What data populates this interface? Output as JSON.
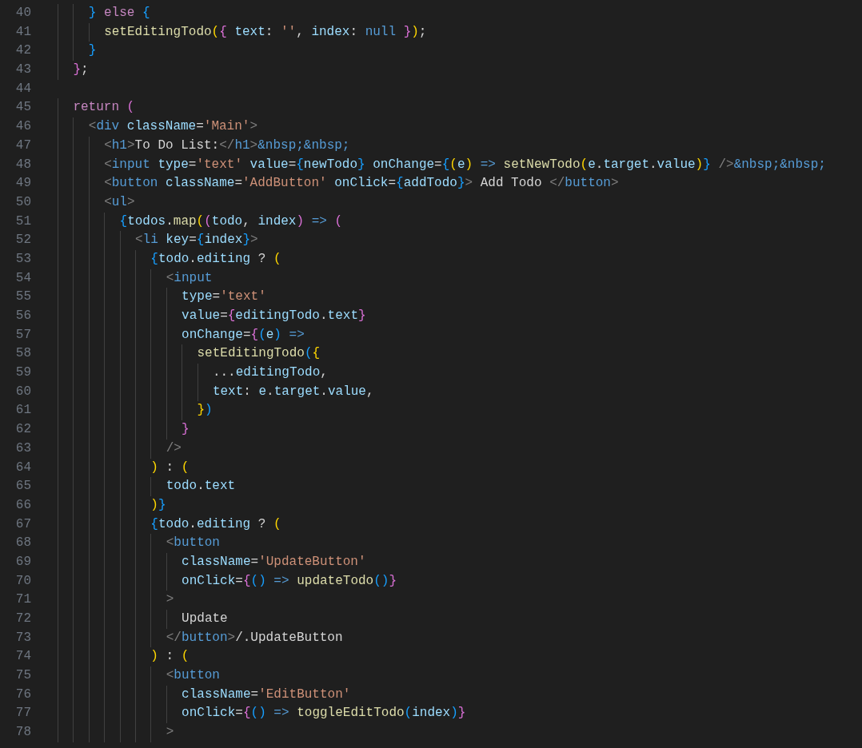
{
  "editor": {
    "lines": [
      {
        "number": "40",
        "tokens": [
          {
            "kind": "b3",
            "text": "      }"
          },
          {
            "kind": "kw",
            "text": " else "
          },
          {
            "kind": "b3",
            "text": "{"
          }
        ]
      },
      {
        "number": "41",
        "tokens": [
          {
            "kind": "fn",
            "text": "        setEditingTodo"
          },
          {
            "kind": "b1",
            "text": "("
          },
          {
            "kind": "b2",
            "text": "{ "
          },
          {
            "kind": "var",
            "text": "text"
          },
          {
            "kind": "plain",
            "text": ": "
          },
          {
            "kind": "str",
            "text": "''"
          },
          {
            "kind": "plain",
            "text": ", "
          },
          {
            "kind": "var",
            "text": "index"
          },
          {
            "kind": "plain",
            "text": ": "
          },
          {
            "kind": "const",
            "text": "null "
          },
          {
            "kind": "b2",
            "text": "}"
          },
          {
            "kind": "b1",
            "text": ")"
          },
          {
            "kind": "plain",
            "text": ";"
          }
        ]
      },
      {
        "number": "42",
        "tokens": [
          {
            "kind": "b3",
            "text": "      }"
          }
        ]
      },
      {
        "number": "43",
        "tokens": [
          {
            "kind": "b2",
            "text": "    }"
          },
          {
            "kind": "plain",
            "text": ";"
          }
        ]
      },
      {
        "number": "44"
      },
      {
        "number": "45",
        "tokens": [
          {
            "kind": "kw",
            "text": "    return "
          },
          {
            "kind": "b2",
            "text": "("
          }
        ]
      },
      {
        "number": "46",
        "tokens": [
          {
            "kind": "punct",
            "text": "      <"
          },
          {
            "kind": "tag",
            "text": "div "
          },
          {
            "kind": "var",
            "text": "className"
          },
          {
            "kind": "plain",
            "text": "="
          },
          {
            "kind": "str",
            "text": "'Main'"
          },
          {
            "kind": "punct",
            "text": ">"
          }
        ]
      },
      {
        "number": "47",
        "tokens": [
          {
            "kind": "punct",
            "text": "        <"
          },
          {
            "kind": "tag",
            "text": "h1"
          },
          {
            "kind": "punct",
            "text": ">"
          },
          {
            "kind": "plain",
            "text": "To Do List:"
          },
          {
            "kind": "punct",
            "text": "</"
          },
          {
            "kind": "tag",
            "text": "h1"
          },
          {
            "kind": "punct",
            "text": ">"
          },
          {
            "kind": "tag",
            "text": "&nbsp;&nbsp;"
          }
        ]
      },
      {
        "number": "48",
        "tokens": [
          {
            "kind": "punct",
            "text": "        <"
          },
          {
            "kind": "tag",
            "text": "input "
          },
          {
            "kind": "var",
            "text": "type"
          },
          {
            "kind": "plain",
            "text": "="
          },
          {
            "kind": "str",
            "text": "'text' "
          },
          {
            "kind": "var",
            "text": "value"
          },
          {
            "kind": "plain",
            "text": "="
          },
          {
            "kind": "b3",
            "text": "{"
          },
          {
            "kind": "var",
            "text": "newTodo"
          },
          {
            "kind": "b3",
            "text": "} "
          },
          {
            "kind": "var",
            "text": "onChange"
          },
          {
            "kind": "plain",
            "text": "="
          },
          {
            "kind": "b3",
            "text": "{"
          },
          {
            "kind": "b1",
            "text": "("
          },
          {
            "kind": "var",
            "text": "e"
          },
          {
            "kind": "b1",
            "text": ") "
          },
          {
            "kind": "arrow",
            "text": "=> "
          },
          {
            "kind": "fn",
            "text": "setNewTodo"
          },
          {
            "kind": "b1",
            "text": "("
          },
          {
            "kind": "var",
            "text": "e"
          },
          {
            "kind": "plain",
            "text": "."
          },
          {
            "kind": "var",
            "text": "target"
          },
          {
            "kind": "plain",
            "text": "."
          },
          {
            "kind": "var",
            "text": "value"
          },
          {
            "kind": "b1",
            "text": ")"
          },
          {
            "kind": "b3",
            "text": "} "
          },
          {
            "kind": "punct",
            "text": "/>"
          },
          {
            "kind": "tag",
            "text": "&nbsp;&nbsp;"
          }
        ]
      },
      {
        "number": "49",
        "tokens": [
          {
            "kind": "punct",
            "text": "        <"
          },
          {
            "kind": "tag",
            "text": "button "
          },
          {
            "kind": "var",
            "text": "className"
          },
          {
            "kind": "plain",
            "text": "="
          },
          {
            "kind": "str",
            "text": "'AddButton' "
          },
          {
            "kind": "var",
            "text": "onClick"
          },
          {
            "kind": "plain",
            "text": "="
          },
          {
            "kind": "b3",
            "text": "{"
          },
          {
            "kind": "var",
            "text": "addTodo"
          },
          {
            "kind": "b3",
            "text": "}"
          },
          {
            "kind": "punct",
            "text": ">"
          },
          {
            "kind": "plain",
            "text": " Add Todo "
          },
          {
            "kind": "punct",
            "text": "</"
          },
          {
            "kind": "tag",
            "text": "button"
          },
          {
            "kind": "punct",
            "text": ">"
          }
        ]
      },
      {
        "number": "50",
        "tokens": [
          {
            "kind": "punct",
            "text": "        <"
          },
          {
            "kind": "tag",
            "text": "ul"
          },
          {
            "kind": "punct",
            "text": ">"
          }
        ]
      },
      {
        "number": "51",
        "tokens": [
          {
            "kind": "b3",
            "text": "          {"
          },
          {
            "kind": "var",
            "text": "todos"
          },
          {
            "kind": "plain",
            "text": "."
          },
          {
            "kind": "fn",
            "text": "map"
          },
          {
            "kind": "b1",
            "text": "("
          },
          {
            "kind": "b2",
            "text": "("
          },
          {
            "kind": "var",
            "text": "todo"
          },
          {
            "kind": "plain",
            "text": ", "
          },
          {
            "kind": "var",
            "text": "index"
          },
          {
            "kind": "b2",
            "text": ") "
          },
          {
            "kind": "arrow",
            "text": "=> "
          },
          {
            "kind": "b2",
            "text": "("
          }
        ]
      },
      {
        "number": "52",
        "tokens": [
          {
            "kind": "punct",
            "text": "            <"
          },
          {
            "kind": "tag",
            "text": "li "
          },
          {
            "kind": "var",
            "text": "key"
          },
          {
            "kind": "plain",
            "text": "="
          },
          {
            "kind": "b3",
            "text": "{"
          },
          {
            "kind": "var",
            "text": "index"
          },
          {
            "kind": "b3",
            "text": "}"
          },
          {
            "kind": "punct",
            "text": ">"
          }
        ]
      },
      {
        "number": "53",
        "tokens": [
          {
            "kind": "b3",
            "text": "              {"
          },
          {
            "kind": "var",
            "text": "todo"
          },
          {
            "kind": "plain",
            "text": "."
          },
          {
            "kind": "var",
            "text": "editing"
          },
          {
            "kind": "plain",
            "text": " ? "
          },
          {
            "kind": "b1",
            "text": "("
          }
        ]
      },
      {
        "number": "54",
        "tokens": [
          {
            "kind": "punct",
            "text": "                <"
          },
          {
            "kind": "tag",
            "text": "input"
          }
        ]
      },
      {
        "number": "55",
        "tokens": [
          {
            "kind": "var",
            "text": "                  type"
          },
          {
            "kind": "plain",
            "text": "="
          },
          {
            "kind": "str",
            "text": "'text'"
          }
        ]
      },
      {
        "number": "56",
        "tokens": [
          {
            "kind": "var",
            "text": "                  value"
          },
          {
            "kind": "plain",
            "text": "="
          },
          {
            "kind": "b2",
            "text": "{"
          },
          {
            "kind": "var",
            "text": "editingTodo"
          },
          {
            "kind": "plain",
            "text": "."
          },
          {
            "kind": "var",
            "text": "text"
          },
          {
            "kind": "b2",
            "text": "}"
          }
        ]
      },
      {
        "number": "57",
        "tokens": [
          {
            "kind": "var",
            "text": "                  onChange"
          },
          {
            "kind": "plain",
            "text": "="
          },
          {
            "kind": "b2",
            "text": "{"
          },
          {
            "kind": "b3",
            "text": "("
          },
          {
            "kind": "var",
            "text": "e"
          },
          {
            "kind": "b3",
            "text": ") "
          },
          {
            "kind": "arrow",
            "text": "=>"
          }
        ]
      },
      {
        "number": "58",
        "tokens": [
          {
            "kind": "fn",
            "text": "                    setEditingTodo"
          },
          {
            "kind": "b3",
            "text": "("
          },
          {
            "kind": "b1",
            "text": "{"
          }
        ]
      },
      {
        "number": "59",
        "tokens": [
          {
            "kind": "plain",
            "text": "                      ..."
          },
          {
            "kind": "var",
            "text": "editingTodo"
          },
          {
            "kind": "plain",
            "text": ","
          }
        ]
      },
      {
        "number": "60",
        "tokens": [
          {
            "kind": "var",
            "text": "                      text"
          },
          {
            "kind": "plain",
            "text": ": "
          },
          {
            "kind": "var",
            "text": "e"
          },
          {
            "kind": "plain",
            "text": "."
          },
          {
            "kind": "var",
            "text": "target"
          },
          {
            "kind": "plain",
            "text": "."
          },
          {
            "kind": "var",
            "text": "value"
          },
          {
            "kind": "plain",
            "text": ","
          }
        ]
      },
      {
        "number": "61",
        "tokens": [
          {
            "kind": "b1",
            "text": "                    }"
          },
          {
            "kind": "b3",
            "text": ")"
          }
        ]
      },
      {
        "number": "62",
        "tokens": [
          {
            "kind": "b2",
            "text": "                  }"
          }
        ]
      },
      {
        "number": "63",
        "tokens": [
          {
            "kind": "punct",
            "text": "                />"
          }
        ]
      },
      {
        "number": "64",
        "tokens": [
          {
            "kind": "b1",
            "text": "              )"
          },
          {
            "kind": "plain",
            "text": " : "
          },
          {
            "kind": "b1",
            "text": "("
          }
        ]
      },
      {
        "number": "65",
        "tokens": [
          {
            "kind": "var",
            "text": "                todo"
          },
          {
            "kind": "plain",
            "text": "."
          },
          {
            "kind": "var",
            "text": "text"
          }
        ]
      },
      {
        "number": "66",
        "tokens": [
          {
            "kind": "b1",
            "text": "              )"
          },
          {
            "kind": "b3",
            "text": "}"
          }
        ]
      },
      {
        "number": "67",
        "tokens": [
          {
            "kind": "b3",
            "text": "              {"
          },
          {
            "kind": "var",
            "text": "todo"
          },
          {
            "kind": "plain",
            "text": "."
          },
          {
            "kind": "var",
            "text": "editing"
          },
          {
            "kind": "plain",
            "text": " ? "
          },
          {
            "kind": "b1",
            "text": "("
          }
        ]
      },
      {
        "number": "68",
        "tokens": [
          {
            "kind": "punct",
            "text": "                <"
          },
          {
            "kind": "tag",
            "text": "button"
          }
        ]
      },
      {
        "number": "69",
        "tokens": [
          {
            "kind": "var",
            "text": "                  className"
          },
          {
            "kind": "plain",
            "text": "="
          },
          {
            "kind": "str",
            "text": "'UpdateButton'"
          }
        ]
      },
      {
        "number": "70",
        "tokens": [
          {
            "kind": "var",
            "text": "                  onClick"
          },
          {
            "kind": "plain",
            "text": "="
          },
          {
            "kind": "b2",
            "text": "{"
          },
          {
            "kind": "b3",
            "text": "() "
          },
          {
            "kind": "arrow",
            "text": "=> "
          },
          {
            "kind": "fn",
            "text": "updateTodo"
          },
          {
            "kind": "b3",
            "text": "()"
          },
          {
            "kind": "b2",
            "text": "}"
          }
        ]
      },
      {
        "number": "71",
        "tokens": [
          {
            "kind": "punct",
            "text": "                >"
          }
        ]
      },
      {
        "number": "72",
        "tokens": [
          {
            "kind": "plain",
            "text": "                  Update"
          }
        ]
      },
      {
        "number": "73",
        "tokens": [
          {
            "kind": "punct",
            "text": "                </"
          },
          {
            "kind": "tag",
            "text": "button"
          },
          {
            "kind": "punct",
            "text": ">"
          },
          {
            "kind": "plain",
            "text": "/.UpdateButton"
          }
        ]
      },
      {
        "number": "74",
        "tokens": [
          {
            "kind": "b1",
            "text": "              )"
          },
          {
            "kind": "plain",
            "text": " : "
          },
          {
            "kind": "b1",
            "text": "("
          }
        ]
      },
      {
        "number": "75",
        "tokens": [
          {
            "kind": "punct",
            "text": "                <"
          },
          {
            "kind": "tag",
            "text": "button"
          }
        ]
      },
      {
        "number": "76",
        "tokens": [
          {
            "kind": "var",
            "text": "                  className"
          },
          {
            "kind": "plain",
            "text": "="
          },
          {
            "kind": "str",
            "text": "'EditButton'"
          }
        ]
      },
      {
        "number": "77",
        "tokens": [
          {
            "kind": "var",
            "text": "                  onClick"
          },
          {
            "kind": "plain",
            "text": "="
          },
          {
            "kind": "b2",
            "text": "{"
          },
          {
            "kind": "b3",
            "text": "() "
          },
          {
            "kind": "arrow",
            "text": "=> "
          },
          {
            "kind": "fn",
            "text": "toggleEditTodo"
          },
          {
            "kind": "b3",
            "text": "("
          },
          {
            "kind": "var",
            "text": "index"
          },
          {
            "kind": "b3",
            "text": ")"
          },
          {
            "kind": "b2",
            "text": "}"
          }
        ]
      },
      {
        "number": "78",
        "tokens": [
          {
            "kind": "punct",
            "text": "                >"
          }
        ]
      }
    ]
  }
}
